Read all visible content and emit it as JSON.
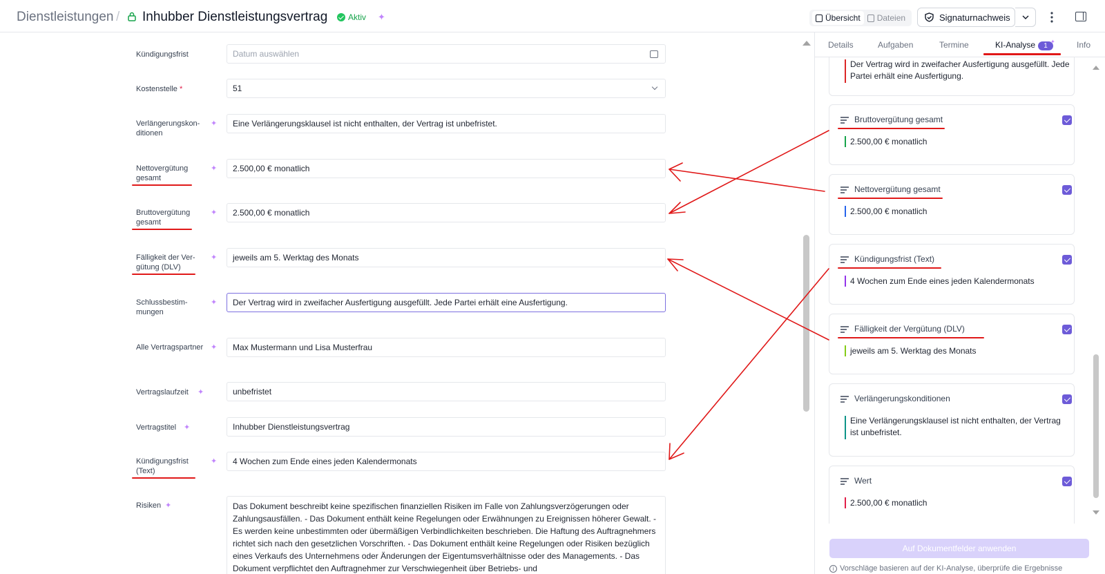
{
  "header": {
    "breadcrumb_root": "Dienstleistungen",
    "separator": "/",
    "title": "Inhubber Dienstleistungsvertrag",
    "status": "Aktiv",
    "view_overview": "Übersicht",
    "view_files": "Dateien",
    "signature_button": "Signaturnachweis"
  },
  "form": {
    "fields": [
      {
        "label": "Kündigungsfrist",
        "value": "",
        "placeholder": "Datum auswählen"
      },
      {
        "label": "Kostenstelle",
        "required_mark": "*",
        "value": "51"
      },
      {
        "label": "Verlängerungskon-ditionen",
        "value": "Eine Verlängerungsklausel ist nicht enthalten, der Vertrag ist unbefristet."
      },
      {
        "label": "Nettovergütung gesamt",
        "value": "2.500,00 € monatlich"
      },
      {
        "label": "Bruttovergütung gesamt",
        "value": "2.500,00 € monatlich"
      },
      {
        "label": "Fälligkeit der Ver-gütung (DLV)",
        "value": "jeweils am 5. Werktag des Monats"
      },
      {
        "label": "Schlussbestim-mungen",
        "value": "Der Vertrag wird in zweifacher Ausfertigung ausgefüllt. Jede Partei erhält eine Ausfertigung."
      },
      {
        "label": "Alle Vertragspartner",
        "value": "Max Mustermann und Lisa Musterfrau"
      },
      {
        "label": "Vertragslaufzeit",
        "value": "unbefristet"
      },
      {
        "label": "Vertragstitel",
        "value": "Inhubber Dienstleistungsvertrag"
      },
      {
        "label": "Kündigungsfrist (Text)",
        "value": "4 Wochen zum Ende eines jeden Kalendermonats"
      },
      {
        "label": "Risiken",
        "value": "Das Dokument beschreibt keine spezifischen finanziellen Risiken im Falle von Zahlungsverzögerungen oder Zahlungsausfällen. - Das Dokument enthält keine Regelungen oder Erwähnungen zu Ereignissen höherer Gewalt. - Es werden keine unbestimmten oder übermäßigen Verbindlichkeiten beschrieben. Die Haftung des Auftragnehmers richtet sich nach den gesetzlichen Vorschriften. - Das Dokument enthält keine Regelungen oder Risiken bezüglich eines Verkaufs des Unternehmens oder Änderungen der Eigentumsverhältnisse oder des Managements. - Das Dokument verpflichtet den Auftragnehmer zur Verschwiegenheit über Betriebs- und"
      }
    ]
  },
  "panel": {
    "tabs": [
      {
        "label": "Details"
      },
      {
        "label": "Aufgaben"
      },
      {
        "label": "Termine"
      },
      {
        "label": "KI-Analyse",
        "badge": "1"
      },
      {
        "label": "Info"
      }
    ],
    "partial_card": {
      "value": "Der Vertrag wird in zweifacher Ausfertigung ausgefüllt. Jede Partei erhält eine Ausfertigung.",
      "bar_color": "#dc2626"
    },
    "cards": [
      {
        "title": "Bruttovergütung gesamt",
        "value": "2.500,00 € monatlich",
        "bar_color": "#16a34a"
      },
      {
        "title": "Nettovergütung gesamt",
        "value": "2.500,00 € monatlich",
        "bar_color": "#2563eb"
      },
      {
        "title": "Kündigungsfrist (Text)",
        "value": "4 Wochen zum Ende eines jeden Kalendermonats",
        "bar_color": "#9333ea"
      },
      {
        "title": "Fälligkeit der Vergütung (DLV)",
        "value": "jeweils am 5. Werktag des Monats",
        "bar_color": "#84cc16"
      },
      {
        "title": "Verlängerungskonditionen",
        "value": "Eine Verlängerungsklausel ist nicht enthalten, der Vertrag ist unbefristet.",
        "bar_color": "#0d9488"
      },
      {
        "title": "Wert",
        "value": "2.500,00 € monatlich",
        "bar_color": "#e11d48"
      }
    ],
    "apply_button": "Auf Dokumentfelder anwenden",
    "footnote": "Vorschläge basieren auf der KI-Analyse, überprüfe die Ergebnisse"
  },
  "colors": {
    "accent": "#6d5bd8",
    "annotation": "#e01818"
  },
  "icons": {
    "sparkle": "✦"
  }
}
